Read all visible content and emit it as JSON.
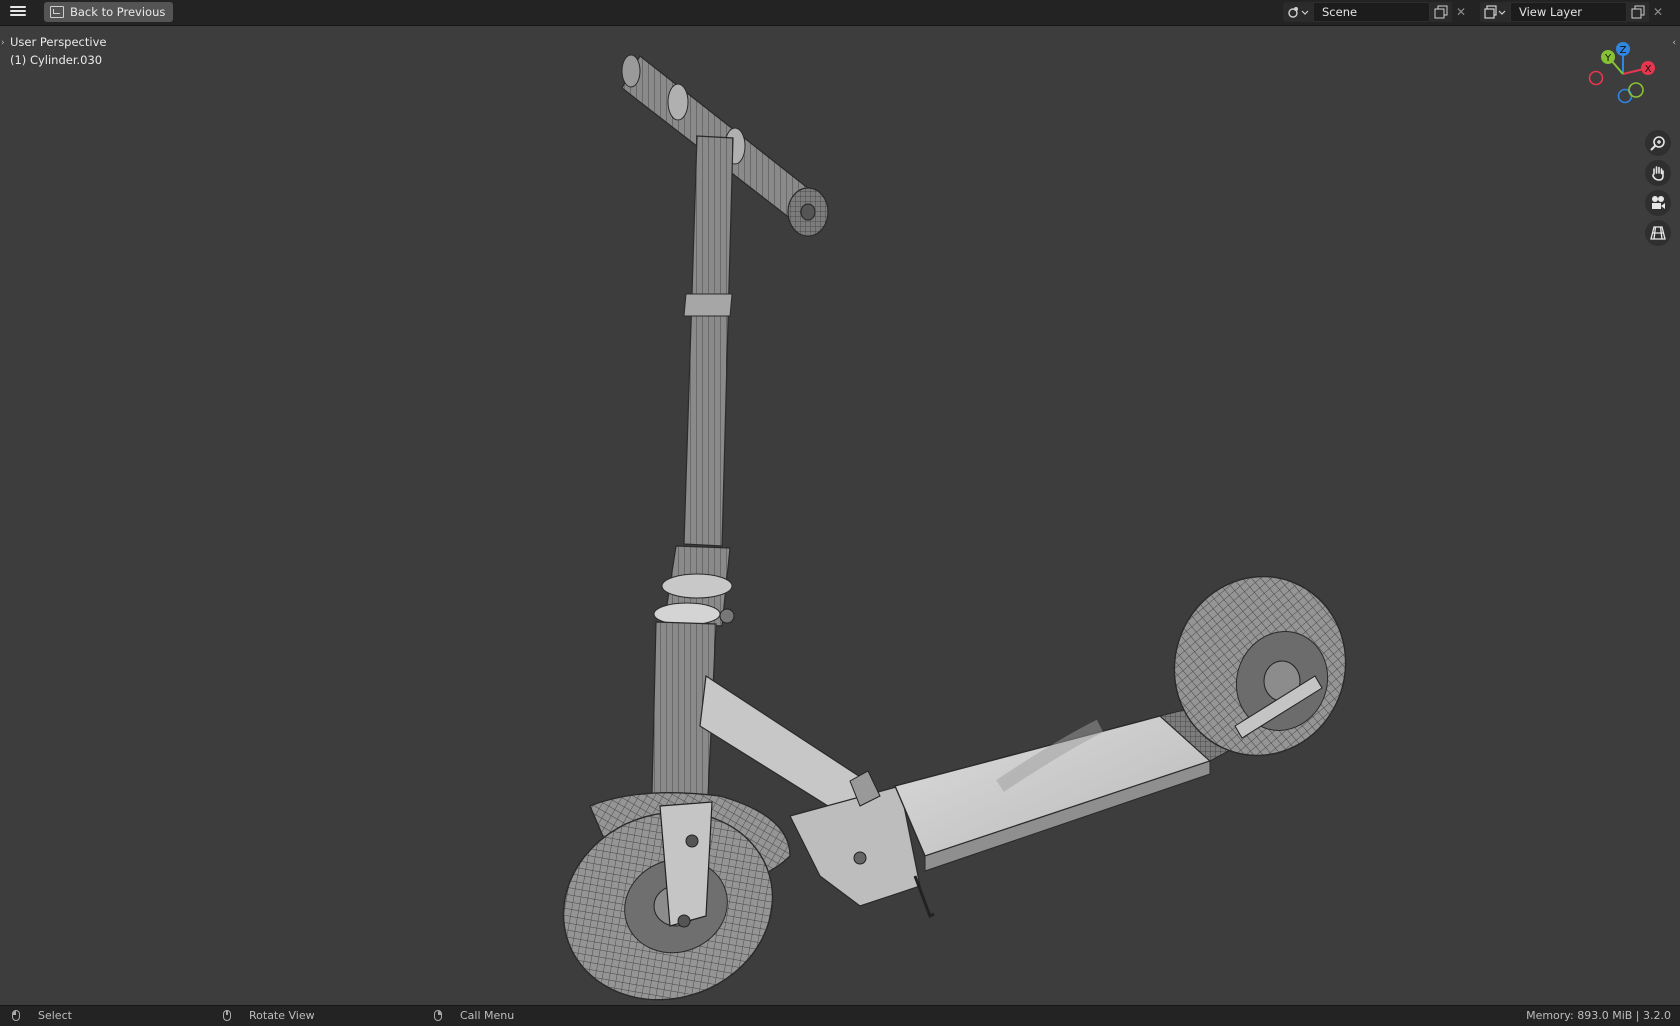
{
  "topbar": {
    "back_label": "Back to Previous",
    "scene_label": "Scene",
    "view_layer_label": "View Layer"
  },
  "viewport": {
    "view_name": "User Perspective",
    "object_name": "(1) Cylinder.030",
    "gizmo": {
      "x_label": "X",
      "y_label": "Y",
      "z_label": "Z"
    },
    "nav_icons": [
      "zoom-icon",
      "hand-pan-icon",
      "camera-icon",
      "grid-perspective-icon"
    ]
  },
  "statusbar": {
    "select_label": "Select",
    "rotate_label": "Rotate View",
    "menu_label": "Call Menu",
    "memory_label": "Memory: 893.0 MiB | 3.2.0"
  },
  "colors": {
    "axis_x": "#e8364e",
    "axis_y": "#87c234",
    "axis_z": "#2f86e0",
    "viewport_bg": "#3d3d3d"
  }
}
